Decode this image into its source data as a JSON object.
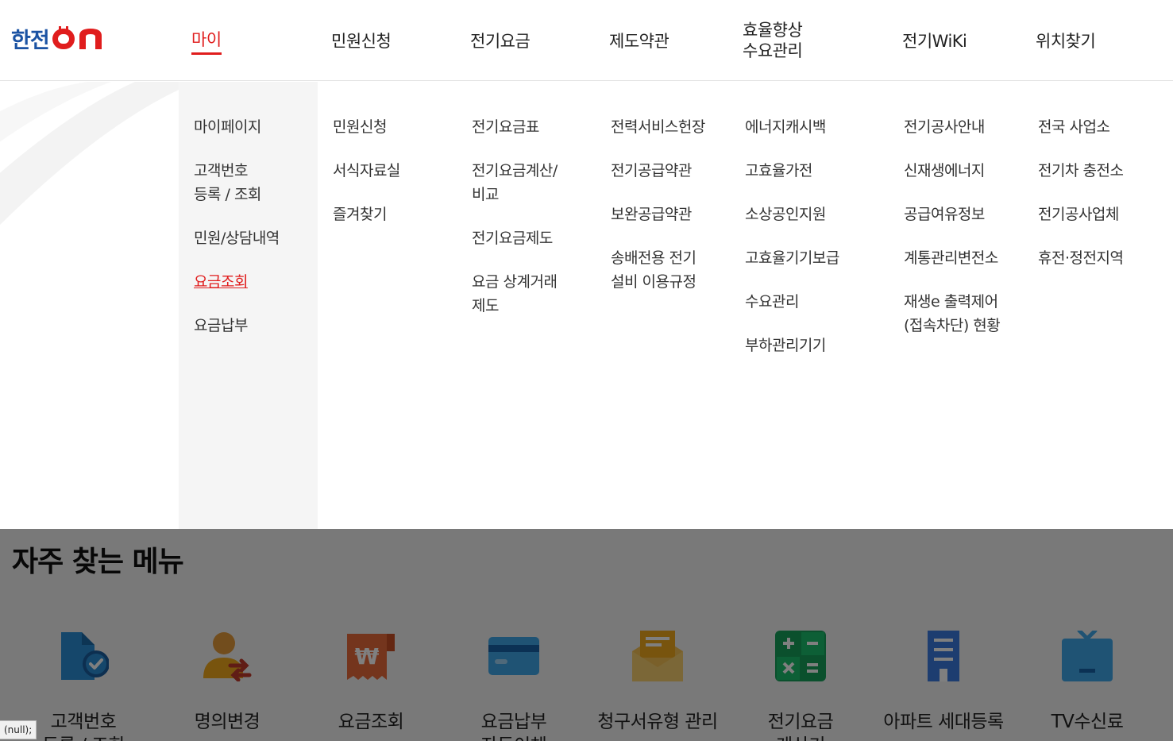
{
  "logo": {
    "text": "한전ON",
    "prefix": "한전"
  },
  "gnb": [
    {
      "label": "마이",
      "active": true
    },
    {
      "label": "민원신청"
    },
    {
      "label": "전기요금"
    },
    {
      "label": "제도약관"
    },
    {
      "label": "효율향상\n수요관리"
    },
    {
      "label": "전기WiKi"
    },
    {
      "label": "위치찾기"
    }
  ],
  "submenu": {
    "my": [
      "마이페이지",
      "고객번호\n등록 / 조회",
      "민원/상담내역",
      "요금조회",
      "요금납부"
    ],
    "complaint": [
      "민원신청",
      "서식자료실",
      "즐겨찾기"
    ],
    "bill": [
      "전기요금표",
      "전기요금계산/\n비교",
      "전기요금제도",
      "요금 상계거래\n제도"
    ],
    "terms": [
      "전력서비스헌장",
      "전기공급약관",
      "보완공급약관",
      "송배전용 전기\n설비 이용규정"
    ],
    "efficiency": [
      "에너지캐시백",
      "고효율가전",
      "소상공인지원",
      "고효율기기보급",
      "수요관리",
      "부하관리기기"
    ],
    "wiki": [
      "전기공사안내",
      "신재생에너지",
      "공급여유정보",
      "계통관리변전소",
      "재생e 출력제어\n(접속차단) 현황"
    ],
    "location": [
      "전국 사업소",
      "전기차 충전소",
      "전기공사업체",
      "휴전·정전지역"
    ],
    "active_item": "요금조회"
  },
  "frequent": {
    "title": "자주 찾는 메뉴",
    "items": [
      {
        "label": "고객번호\n등록 / 조회",
        "icon": "document-check-icon"
      },
      {
        "label": "명의변경",
        "icon": "person-transfer-icon"
      },
      {
        "label": "요금조회",
        "icon": "won-receipt-icon"
      },
      {
        "label": "요금납부\n자동이체",
        "icon": "credit-card-icon"
      },
      {
        "label": "청구서유형 관리",
        "icon": "mail-envelope-icon"
      },
      {
        "label": "전기요금\n계산기",
        "icon": "calculator-icon"
      },
      {
        "label": "아파트 세대등록",
        "icon": "apartment-building-icon"
      },
      {
        "label": "TV수신료",
        "icon": "television-icon"
      }
    ]
  },
  "status_text": "(null);",
  "colors": {
    "brand_blue": "#1b53a3",
    "brand_red": "#e01d1d",
    "active_text": "#e01d1d",
    "submenu_first_col_bg": "#f5f5f5"
  }
}
